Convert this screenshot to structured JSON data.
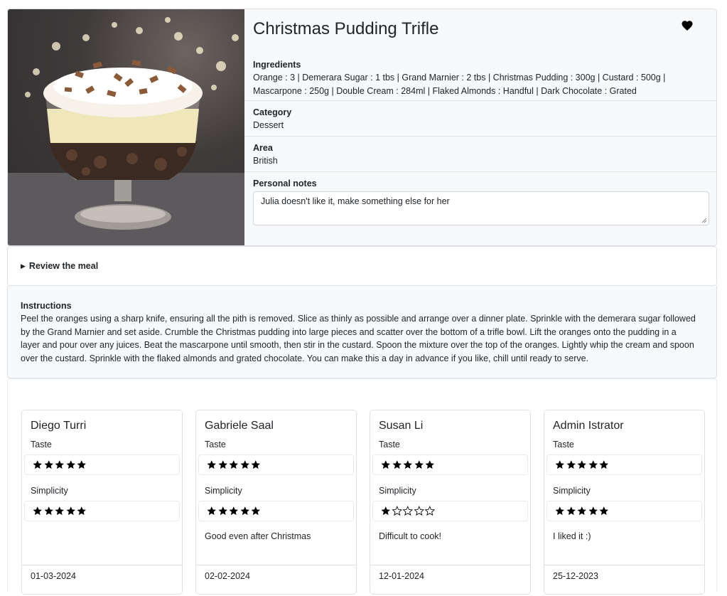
{
  "meal": {
    "title": "Christmas Pudding Trifle",
    "image_alt": "Christmas Pudding Trifle",
    "ingredients_label": "Ingredients",
    "ingredients_line1": "Orange : 3 | Demerara Sugar : 1 tbs | Grand Marnier : 2 tbs | Christmas Pudding : 300g | Custard : 500g |",
    "ingredients_line2": "Mascarpone : 250g | Double Cream : 284ml | Flaked Almonds : Handful | Dark Chocolate : Grated",
    "category_label": "Category",
    "category": "Dessert",
    "area_label": "Area",
    "area": "British",
    "notes_label": "Personal notes",
    "notes": "Julia doesn't like it, make something else for her",
    "favorite": true
  },
  "review_toggle": {
    "label": "Review the meal"
  },
  "instructions": {
    "label": "Instructions",
    "lines": [
      "Peel the oranges using a sharp knife, ensuring all the pith is removed. Slice as thinly as possible and arrange over a dinner plate. Sprinkle with the demerara sugar followed",
      "by the Grand Marnier and set aside. Crumble the Christmas pudding into large pieces and scatter over the bottom of a trifle bowl. Lift the oranges onto the pudding in a",
      "layer and pour over any juices. Beat the mascarpone until smooth, then stir in the custard. Spoon the mixture over the top of the oranges. Lightly whip the cream and spoon",
      "over the custard. Sprinkle with the flaked almonds and grated chocolate. You can make this a day in advance if you like, chill until ready to serve."
    ]
  },
  "reviews": [
    {
      "name": "Diego Turri",
      "taste_label": "Taste",
      "taste": 5,
      "simplicity_label": "Simplicity",
      "simplicity": 5,
      "comment": "",
      "date": "01-03-2024"
    },
    {
      "name": "Gabriele Saal",
      "taste_label": "Taste",
      "taste": 5,
      "simplicity_label": "Simplicity",
      "simplicity": 5,
      "comment": "Good even after Christmas",
      "date": "02-02-2024"
    },
    {
      "name": "Susan Li",
      "taste_label": "Taste",
      "taste": 5,
      "simplicity_label": "Simplicity",
      "simplicity": 1,
      "comment": "Difficult to cook!",
      "date": "12-01-2024"
    },
    {
      "name": "Admin Istrator",
      "taste_label": "Taste",
      "taste": 5,
      "simplicity_label": "Simplicity",
      "simplicity": 5,
      "comment": "I liked it :)",
      "date": "25-12-2023"
    }
  ],
  "max_stars": 5,
  "icons": {
    "favorite": "heart-icon",
    "rating": "star-icon",
    "toggle": "triangle-right-icon"
  }
}
